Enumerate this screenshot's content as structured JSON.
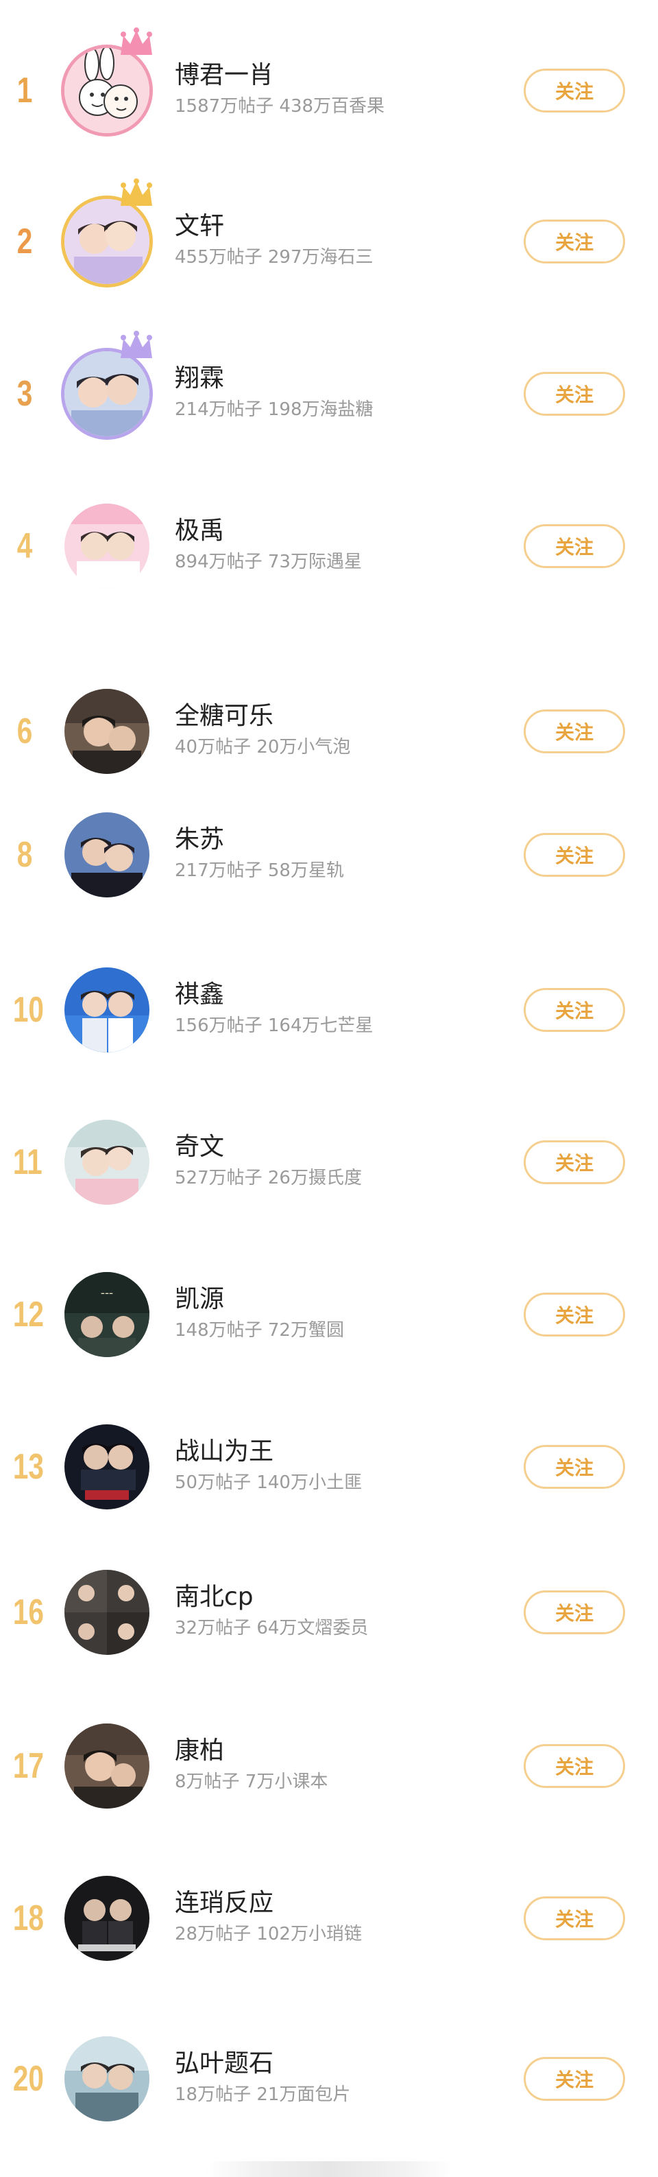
{
  "follow_label": "关注",
  "colors": {
    "accent": "#e8a53f",
    "button_border": "#f5cf8f",
    "rank_top": "#e9a44c",
    "rank_other": "#f1c36d"
  },
  "rows": [
    {
      "rank": "1",
      "name": "博君一肖",
      "stats": "1587万帖子 438万百香果",
      "crown": "pink-crown-icon"
    },
    {
      "rank": "2",
      "name": "文轩",
      "stats": "455万帖子 297万海石三",
      "crown": "gold-crown-icon"
    },
    {
      "rank": "3",
      "name": "翔霖",
      "stats": "214万帖子 198万海盐糖",
      "crown": "purple-crown-icon"
    },
    {
      "rank": "4",
      "name": "极禹",
      "stats": "894万帖子 73万际遇星"
    },
    {
      "rank": "6",
      "name": "全糖可乐",
      "stats": "40万帖子 20万小气泡"
    },
    {
      "rank": "8",
      "name": "朱苏",
      "stats": "217万帖子 58万星轨"
    },
    {
      "rank": "10",
      "name": "祺鑫",
      "stats": "156万帖子 164万七芒星"
    },
    {
      "rank": "11",
      "name": "奇文",
      "stats": "527万帖子 26万摄氏度"
    },
    {
      "rank": "12",
      "name": "凯源",
      "stats": "148万帖子 72万蟹圆"
    },
    {
      "rank": "13",
      "name": "战山为王",
      "stats": "50万帖子 140万小土匪"
    },
    {
      "rank": "16",
      "name": "南北cp",
      "stats": "32万帖子 64万文熠委员"
    },
    {
      "rank": "17",
      "name": "康柏",
      "stats": "8万帖子 7万小课本"
    },
    {
      "rank": "18",
      "name": "连琑反应",
      "stats": "28万帖子 102万小琑链"
    },
    {
      "rank": "20",
      "name": "弘叶题石",
      "stats": "18万帖子 21万面包片"
    }
  ]
}
